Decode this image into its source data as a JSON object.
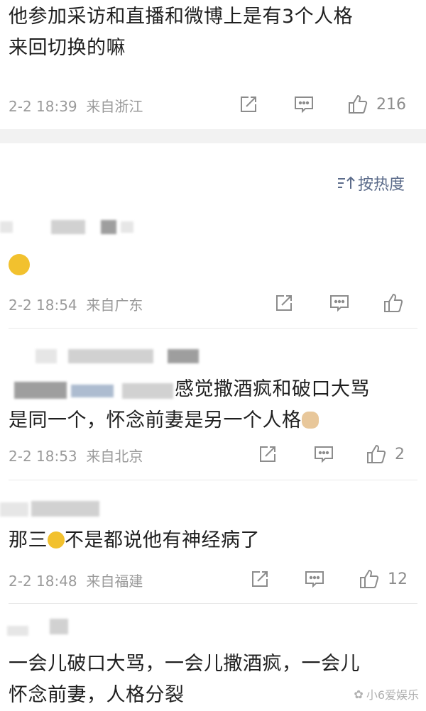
{
  "comments": [
    {
      "text_line1": "他参加采访和直播和微博上是有3个人格",
      "text_line2": "来回切换的嘛",
      "time": "2-2 18:39",
      "location": "来自浙江",
      "likes": "216"
    },
    {
      "time": "2-2 18:54",
      "location": "来自广东",
      "likes": ""
    },
    {
      "text_line1": "感觉撒酒疯和破口大骂",
      "text_line2": "是同一个，怀念前妻是另一个人格",
      "time": "2-2 18:53",
      "location": "来自北京",
      "likes": "2"
    },
    {
      "text_before_emoji": "那三",
      "text_after_emoji": "不是都说他有神经病了",
      "time": "2-2 18:48",
      "location": "来自福建",
      "likes": "12"
    },
    {
      "text_line1": "一会儿破口大骂，一会儿撒酒疯，一会儿",
      "text_line2": "怀念前妻，人格分裂"
    }
  ],
  "sort": {
    "label": "按热度",
    "icon": "sort-icon"
  },
  "watermark": {
    "text": "小6爱娱乐"
  }
}
